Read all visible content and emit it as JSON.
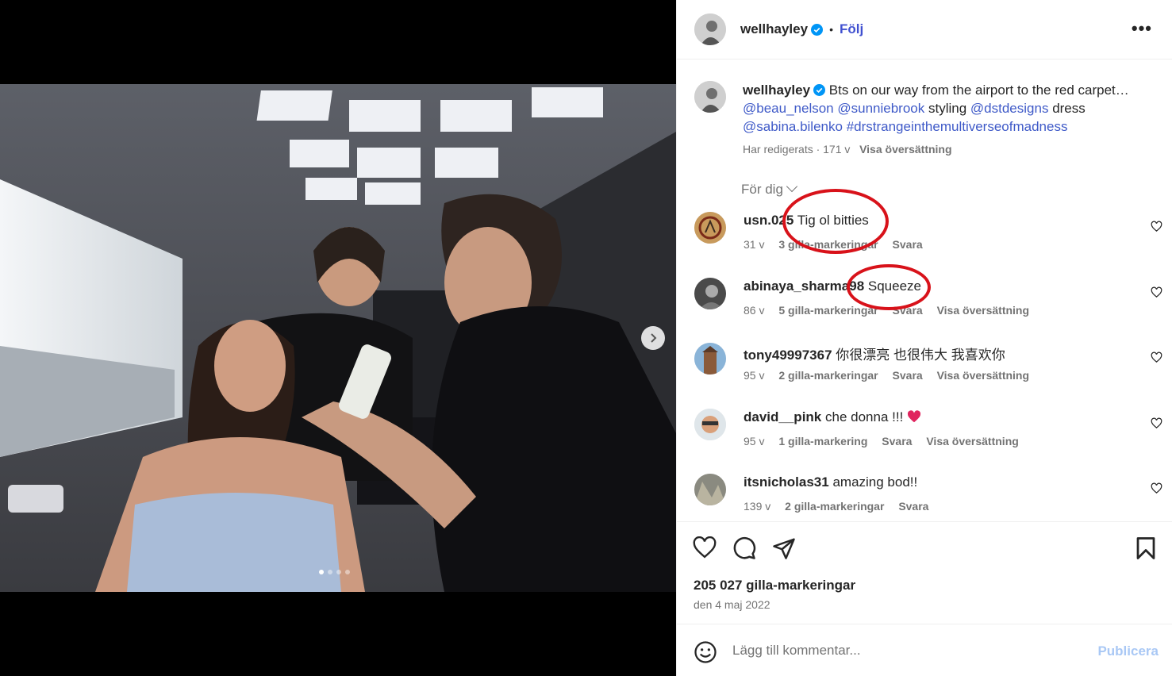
{
  "post": {
    "username": "wellhayley",
    "follow_label": "Följ",
    "more_label": "•••",
    "caption": {
      "text": "Bts on our way from the airport to the red carpet…",
      "mention_1": "@beau_nelson",
      "mention_2": "@sunniebrook",
      "word_styling": "styling",
      "mention_3": "@dstdesigns",
      "word_dress": "dress",
      "mention_4": "@sabina.bilenko",
      "hashtag": "#drstrangeinthemultiverseofmadness",
      "edited": "Har redigerats · 171 v",
      "translate": "Visa översättning"
    },
    "for_you": "För dig",
    "likes": "205 027 gilla-markeringar",
    "date": "den 4 maj 2022",
    "composer": {
      "placeholder": "Lägg till kommentar...",
      "publish": "Publicera"
    },
    "carousel": {
      "slides": 4,
      "active": 1
    }
  },
  "comments": [
    {
      "user": "usn.025",
      "text": "Tig ol bitties",
      "age": "31 v",
      "likes": "3 gilla-markeringar",
      "reply": "Svara",
      "translate": ""
    },
    {
      "user": "abinaya_sharma98",
      "text": "Squeeze",
      "age": "86 v",
      "likes": "5 gilla-markeringar",
      "reply": "Svara",
      "translate": "Visa översättning"
    },
    {
      "user": "tony49997367",
      "text": "你很漂亮 也很伟大 我喜欢你",
      "age": "95 v",
      "likes": "2 gilla-markeringar",
      "reply": "Svara",
      "translate": "Visa översättning"
    },
    {
      "user": "david__pink",
      "text": "che donna !!! ",
      "age": "95 v",
      "likes": "1 gilla-markering",
      "reply": "Svara",
      "translate": "Visa översättning"
    },
    {
      "user": "itsnicholas31",
      "text": "amazing bod!!",
      "age": "139 v",
      "likes": "2 gilla-markeringar",
      "reply": "Svara",
      "translate": ""
    }
  ],
  "colors": {
    "link": "#3f5ac8",
    "annotation": "#d8121a",
    "verified": "#0095f6",
    "heart_emoji": "#e0245e"
  },
  "icons": [
    "verified-badge-icon",
    "more-icon",
    "chevron-down-icon",
    "heart-icon",
    "comment-icon",
    "share-icon",
    "bookmark-icon",
    "emoji-icon",
    "next-arrow-icon"
  ]
}
